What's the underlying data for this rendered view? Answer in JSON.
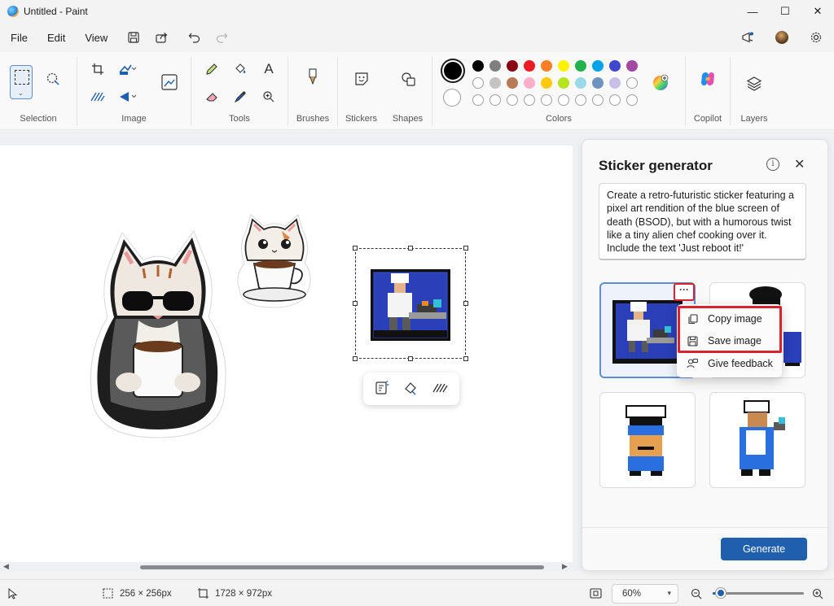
{
  "window": {
    "title": "Untitled - Paint",
    "minimize": "—",
    "maximize": "☐",
    "close": "✕"
  },
  "menu": {
    "file": "File",
    "edit": "Edit",
    "view": "View"
  },
  "ribbon": {
    "selection_label": "Selection",
    "image_label": "Image",
    "tools_label": "Tools",
    "brushes_label": "Brushes",
    "stickers_label": "Stickers",
    "shapes_label": "Shapes",
    "colors_label": "Colors",
    "copilot_label": "Copilot",
    "layers_label": "Layers",
    "tools_text_glyph": "A",
    "primary_color": "#000000",
    "secondary_color": "#ffffff",
    "palette_row1": [
      "#000000",
      "#7f7f7f",
      "#880015",
      "#ed1c24",
      "#ff7f27",
      "#fff200",
      "#22b14c",
      "#00a2e8",
      "#3f48cc",
      "#a349a4"
    ],
    "palette_row2": [
      "#ffffff",
      "#c3c3c3",
      "#b97a57",
      "#ffaec9",
      "#ffc90e",
      "#b5e61d",
      "#99d9ea",
      "#7092be",
      "#c8bfe7"
    ]
  },
  "panel": {
    "title": "Sticker generator",
    "info": "i",
    "close": "✕",
    "prompt": "Create a retro-futuristic sticker featuring a pixel art rendition of the blue screen of death (BSOD), but with a humorous twist like a tiny alien chef cooking over it. Include the text 'Just reboot it!'",
    "generate_label": "Generate",
    "more_label": "···"
  },
  "context_menu": {
    "copy_image": "Copy image",
    "save_image": "Save image",
    "give_feedback": "Give feedback"
  },
  "status": {
    "selection_size": "256 × 256px",
    "canvas_size": "1728 × 972px",
    "zoom": "60%",
    "zoom_level": 0.05
  }
}
